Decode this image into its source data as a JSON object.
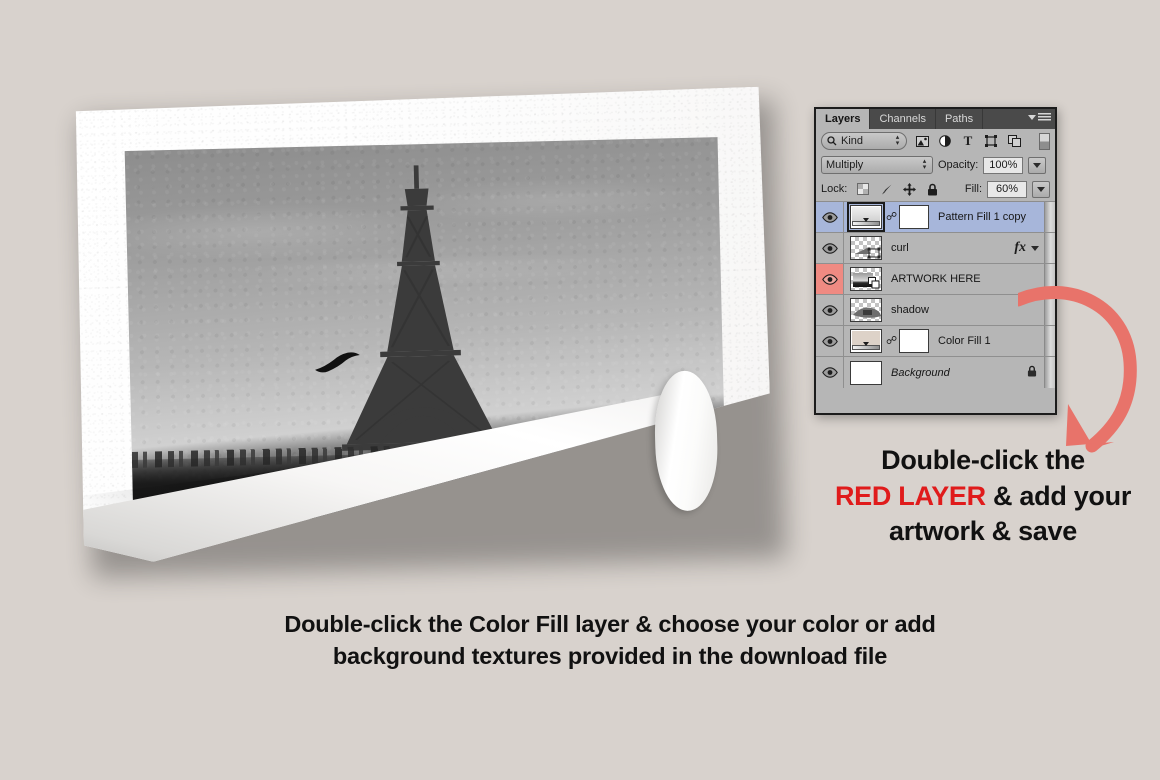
{
  "background_color": "#d8d2cd",
  "mockup": {
    "name": "photo-paper-mockup",
    "description": "Black and white photograph of the Eiffel Tower with a bird, printed on white paper with a curled bottom-right corner"
  },
  "panel": {
    "tabs": [
      {
        "label": "Layers",
        "active": true
      },
      {
        "label": "Channels",
        "active": false
      },
      {
        "label": "Paths",
        "active": false
      }
    ],
    "filter": {
      "kind_label": "Kind",
      "icons": [
        "pixel-layer-filter-icon",
        "adjustment-layer-filter-icon",
        "type-layer-filter-icon",
        "shape-layer-filter-icon",
        "smart-object-filter-icon"
      ],
      "toggle_name": "filter-enable-toggle"
    },
    "blend": {
      "mode": "Multiply",
      "opacity_label": "Opacity:",
      "opacity_value": "100%"
    },
    "lock": {
      "label": "Lock:",
      "icons": [
        "lock-transparent-pixels-icon",
        "lock-image-pixels-icon",
        "lock-position-icon",
        "lock-all-icon"
      ],
      "fill_label": "Fill:",
      "fill_value": "60%"
    },
    "layers": [
      {
        "name": "Pattern Fill 1 copy",
        "visible": true,
        "selected": true,
        "eye_red": false,
        "thumb_type": "gradient-fill",
        "has_mask": true,
        "has_link": true,
        "has_fx": false,
        "locked": false,
        "italic": false
      },
      {
        "name": "curl",
        "visible": true,
        "selected": false,
        "eye_red": false,
        "thumb_type": "transparent-shape",
        "has_mask": false,
        "has_link": false,
        "has_fx": true,
        "locked": false,
        "italic": false
      },
      {
        "name": "ARTWORK HERE",
        "visible": true,
        "selected": false,
        "eye_red": true,
        "thumb_type": "smart-object-photo",
        "has_mask": false,
        "has_link": false,
        "has_fx": false,
        "locked": false,
        "italic": false
      },
      {
        "name": "shadow",
        "visible": true,
        "selected": false,
        "eye_red": false,
        "thumb_type": "transparent-shadow",
        "has_mask": false,
        "has_link": false,
        "has_fx": false,
        "locked": false,
        "italic": false
      },
      {
        "name": "Color Fill 1",
        "visible": true,
        "selected": false,
        "eye_red": false,
        "thumb_type": "solid-color-fill",
        "has_mask": true,
        "has_link": true,
        "has_fx": false,
        "locked": false,
        "italic": false
      },
      {
        "name": "Background",
        "visible": true,
        "selected": false,
        "eye_red": false,
        "thumb_type": "white",
        "has_mask": false,
        "has_link": false,
        "has_fx": false,
        "locked": true,
        "italic": true
      }
    ]
  },
  "arrow": {
    "name": "curved-red-arrow",
    "color": "#e8736a"
  },
  "instructions": {
    "right": {
      "line1": "Double-click the",
      "line2_red": "RED LAYER",
      "line2_rest": " & add your",
      "line3": "artwork & save"
    },
    "bottom": {
      "line1": "Double-click the Color Fill layer & choose  your color or add",
      "line2": "background textures provided in the download file"
    }
  }
}
